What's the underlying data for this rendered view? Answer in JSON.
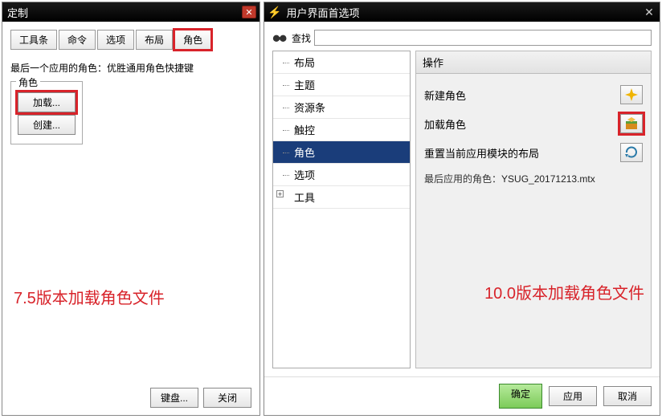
{
  "left": {
    "title": "定制",
    "tabs": [
      "工具条",
      "命令",
      "选项",
      "布局",
      "角色"
    ],
    "selected_tab_index": 4,
    "desc": "最后一个应用的角色：优胜通用角色快捷键",
    "fieldset_legend": "角色",
    "buttons": {
      "load": "加载...",
      "create": "创建..."
    },
    "annotation": "7.5版本加载角色文件",
    "footer": {
      "keyboard": "键盘...",
      "close": "关闭"
    }
  },
  "right": {
    "title": "用户界面首选项",
    "search_label": "查找",
    "search_value": "",
    "tree": [
      {
        "label": "布局",
        "expandable": false
      },
      {
        "label": "主题",
        "expandable": false
      },
      {
        "label": "资源条",
        "expandable": false
      },
      {
        "label": "触控",
        "expandable": false
      },
      {
        "label": "角色",
        "expandable": false,
        "selected": true
      },
      {
        "label": "选项",
        "expandable": false
      },
      {
        "label": "工具",
        "expandable": true
      }
    ],
    "ops_header": "操作",
    "ops": {
      "new_role": "新建角色",
      "load_role": "加载角色",
      "reset_layout": "重置当前应用模块的布局",
      "last_applied_label": "最后应用的角色：",
      "last_applied_file": "YSUG_20171213.mtx"
    },
    "annotation": "10.0版本加载角色文件",
    "footer": {
      "ok": "确定",
      "apply": "应用",
      "cancel": "取消"
    }
  }
}
